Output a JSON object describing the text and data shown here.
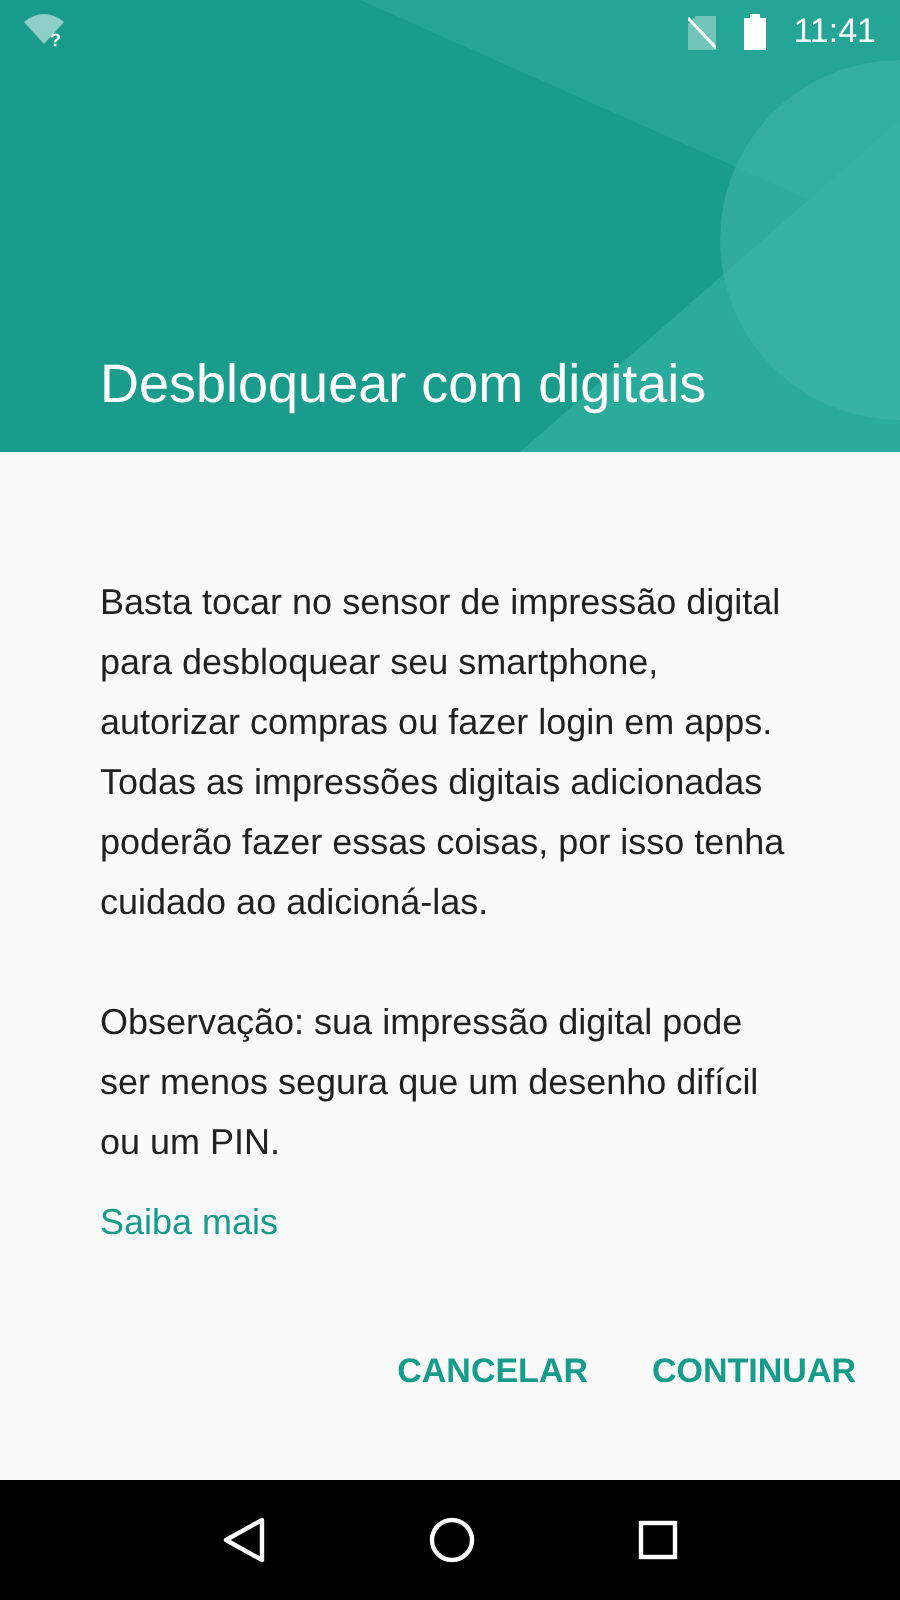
{
  "status_bar": {
    "time": "11:41",
    "wifi_badge": "?"
  },
  "header": {
    "title": "Desbloquear com digitais"
  },
  "body": {
    "paragraphs": [
      "Basta tocar no sensor de impressão digital para desbloquear seu smartphone, autorizar compras ou fazer login em apps. Todas as impressões digitais adicionadas poderão fazer essas coisas, por isso tenha cuidado ao adicioná-las.",
      "Observação: sua impressão digital pode ser menos segura que um desenho difícil ou um PIN."
    ],
    "link": "Saiba mais"
  },
  "buttons": [
    "CANCELAR",
    "CONTINUAR"
  ]
}
